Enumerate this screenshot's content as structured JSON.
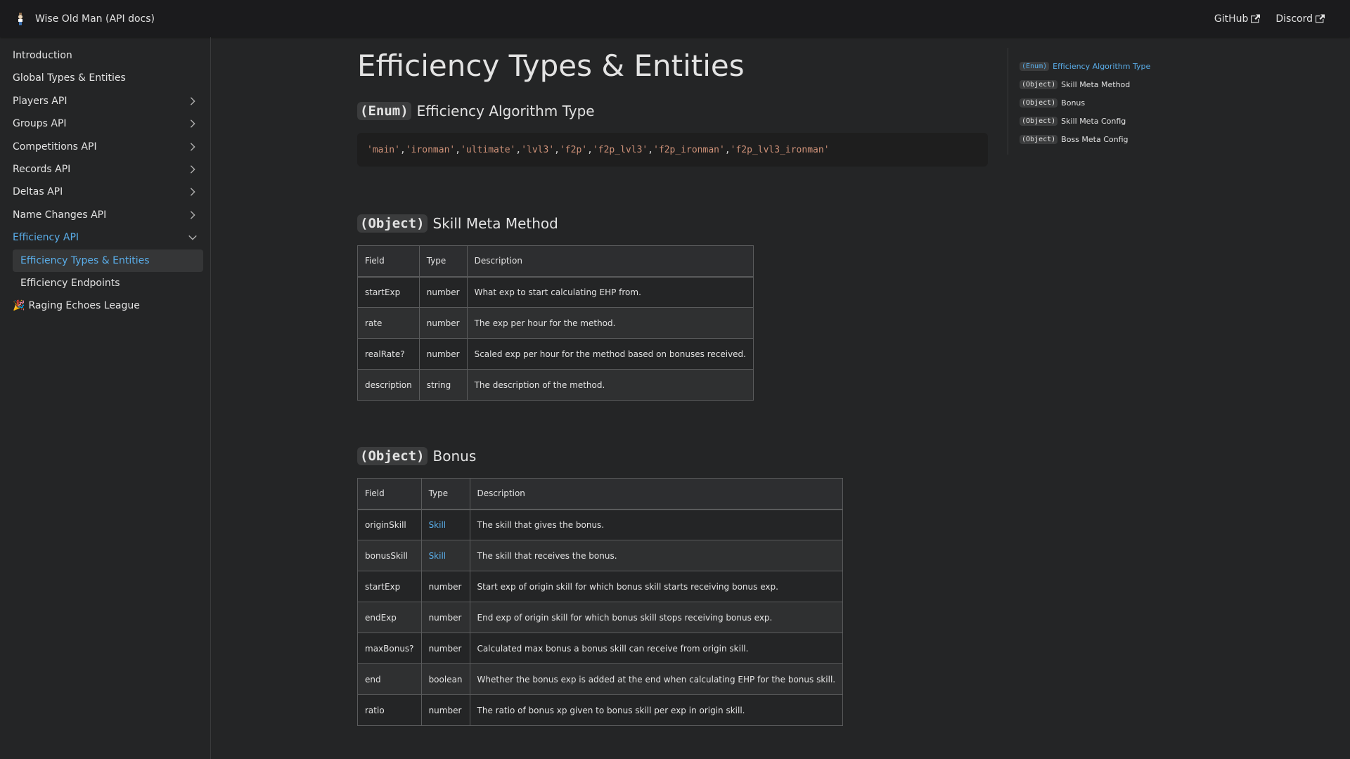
{
  "navbar": {
    "title": "Wise Old Man (API docs)",
    "links": [
      {
        "label": "GitHub"
      },
      {
        "label": "Discord"
      }
    ]
  },
  "sidebar": {
    "items": [
      {
        "label": "Introduction",
        "expandable": false
      },
      {
        "label": "Global Types & Entities",
        "expandable": false
      },
      {
        "label": "Players API",
        "expandable": true
      },
      {
        "label": "Groups API",
        "expandable": true
      },
      {
        "label": "Competitions API",
        "expandable": true
      },
      {
        "label": "Records API",
        "expandable": true
      },
      {
        "label": "Deltas API",
        "expandable": true
      },
      {
        "label": "Name Changes API",
        "expandable": true
      },
      {
        "label": "Efficiency API",
        "expandable": true,
        "expanded": true
      }
    ],
    "subitems": [
      {
        "label": "Efficiency Types & Entities",
        "active": true
      },
      {
        "label": "Efficiency Endpoints",
        "active": false
      }
    ],
    "league": {
      "emoji": "🎉",
      "label": "Raging Echoes League"
    }
  },
  "main": {
    "title": "Efficiency Types & Entities",
    "enum_section": {
      "tag": "(Enum)",
      "title": "Efficiency Algorithm Type",
      "values": [
        "'main'",
        "'ironman'",
        "'ultimate'",
        "'lvl3'",
        "'f2p'",
        "'f2p_lvl3'",
        "'f2p_ironman'",
        "'f2p_lvl3_ironman'"
      ],
      "separator": ", "
    },
    "skill_meta": {
      "tag": "(Object)",
      "title": "Skill Meta Method",
      "headers": [
        "Field",
        "Type",
        "Description"
      ],
      "rows": [
        [
          "startExp",
          "number",
          "What exp to start calculating EHP from."
        ],
        [
          "rate",
          "number",
          "The exp per hour for the method."
        ],
        [
          "realRate?",
          "number",
          "Scaled exp per hour for the method based on bonuses received."
        ],
        [
          "description",
          "string",
          "The description of the method."
        ]
      ]
    },
    "bonus": {
      "tag": "(Object)",
      "title": "Bonus",
      "headers": [
        "Field",
        "Type",
        "Description"
      ],
      "rows": [
        [
          "originSkill",
          "Skill",
          "The skill that gives the bonus."
        ],
        [
          "bonusSkill",
          "Skill",
          "The skill that receives the bonus."
        ],
        [
          "startExp",
          "number",
          "Start exp of origin skill for which bonus skill starts receiving bonus exp."
        ],
        [
          "endExp",
          "number",
          "End exp of origin skill for which bonus skill stops receiving bonus exp."
        ],
        [
          "maxBonus?",
          "number",
          "Calculated max bonus a bonus skill can receive from origin skill."
        ],
        [
          "end",
          "boolean",
          "Whether the bonus exp is added at the end when calculating EHP for the bonus skill."
        ],
        [
          "ratio",
          "number",
          "The ratio of bonus xp given to bonus skill per exp in origin skill."
        ]
      ]
    }
  },
  "toc": {
    "items": [
      {
        "tag": "(Enum)",
        "label": "Efficiency Algorithm Type",
        "active": true
      },
      {
        "tag": "(Object)",
        "label": "Skill Meta Method",
        "active": false
      },
      {
        "tag": "(Object)",
        "label": "Bonus",
        "active": false
      },
      {
        "tag": "(Object)",
        "label": "Skill Meta Config",
        "active": false
      },
      {
        "tag": "(Object)",
        "label": "Boss Meta Config",
        "active": false
      }
    ]
  },
  "colors": {
    "background": "#242526",
    "navbar": "#1b1b1d",
    "accent_link": "#5aaeea",
    "code_string": "#ce9178"
  }
}
